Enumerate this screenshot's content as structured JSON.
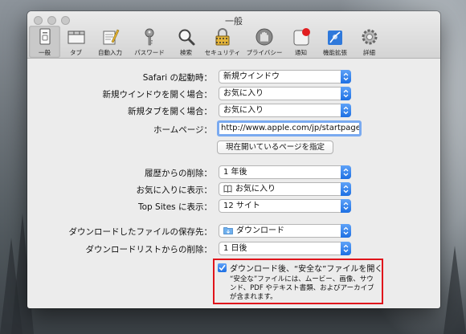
{
  "window": {
    "title": "一般"
  },
  "toolbar": {
    "items": [
      {
        "label": "一般",
        "icon": "general-icon",
        "selected": true
      },
      {
        "label": "タブ",
        "icon": "tabs-icon"
      },
      {
        "label": "自動入力",
        "icon": "autofill-icon"
      },
      {
        "label": "パスワード",
        "icon": "passwords-icon"
      },
      {
        "label": "検索",
        "icon": "search-icon"
      },
      {
        "label": "セキュリティ",
        "icon": "security-icon"
      },
      {
        "label": "プライバシー",
        "icon": "privacy-icon"
      },
      {
        "label": "通知",
        "icon": "notifications-icon"
      },
      {
        "label": "機能拡張",
        "icon": "extensions-icon"
      },
      {
        "label": "詳細",
        "icon": "advanced-icon"
      }
    ]
  },
  "settings": {
    "safari_opens_with": {
      "label": "Safari の起動時：",
      "value": "新規ウインドウ"
    },
    "new_windows_open_with": {
      "label": "新規ウインドウを開く場合：",
      "value": "お気に入り"
    },
    "new_tabs_open_with": {
      "label": "新規タブを開く場合：",
      "value": "お気に入り"
    },
    "homepage": {
      "label": "ホームページ：",
      "value": "http://www.apple.com/jp/startpage/"
    },
    "set_current_page": {
      "label": "現在開いているページを指定"
    },
    "remove_history": {
      "label": "履歴からの削除：",
      "value": "1 年後"
    },
    "favorites_shows": {
      "label": "お気に入りに表示：",
      "value": "お気に入り",
      "icon": "book-icon"
    },
    "top_sites_shows": {
      "label": "Top Sites に表示：",
      "value": "12 サイト"
    },
    "download_location": {
      "label": "ダウンロードしたファイルの保存先：",
      "value": "ダウンロード",
      "icon": "folder-icon"
    },
    "remove_download_list": {
      "label": "ダウンロードリストからの削除：",
      "value": "1 日後"
    },
    "open_safe_files": {
      "label": "ダウンロード後、“安全な”ファイルを開く",
      "checked": true,
      "description": "“安全な”ファイルには、ムービー、画像、サウンド、PDF やテキスト書類、およびアーカイブが含まれます。"
    }
  },
  "help": {
    "label": "?"
  },
  "colors": {
    "accent": "#1d6fe3",
    "highlight": "#e0141b"
  }
}
